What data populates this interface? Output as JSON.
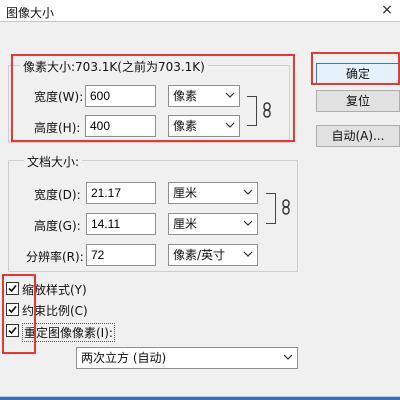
{
  "window": {
    "title": "图像大小",
    "close_label": "×"
  },
  "pixel_dims": {
    "title": "像素大小:703.1K(之前为703.1K)",
    "width_label": "宽度(W):",
    "width_value": "600",
    "width_unit": "像素",
    "height_label": "高度(H):",
    "height_value": "400",
    "height_unit": "像素"
  },
  "doc_size": {
    "title": "文档大小:",
    "width_label": "宽度(D):",
    "width_value": "21.17",
    "width_unit": "厘米",
    "height_label": "高度(G):",
    "height_value": "14.11",
    "height_unit": "厘米",
    "resolution_label": "分辨率(R):",
    "resolution_value": "72",
    "resolution_unit": "像素/英寸"
  },
  "buttons": {
    "ok": "确定",
    "reset": "复位",
    "auto": "自动(A)..."
  },
  "options": {
    "scale_styles": {
      "label": "缩放样式(Y)",
      "checked": true
    },
    "constrain": {
      "label": "约束比例(C)",
      "checked": true
    },
    "resample": {
      "label": "重定图像像素(I):",
      "checked": true
    },
    "resample_method": "两次立方 (自动)"
  }
}
